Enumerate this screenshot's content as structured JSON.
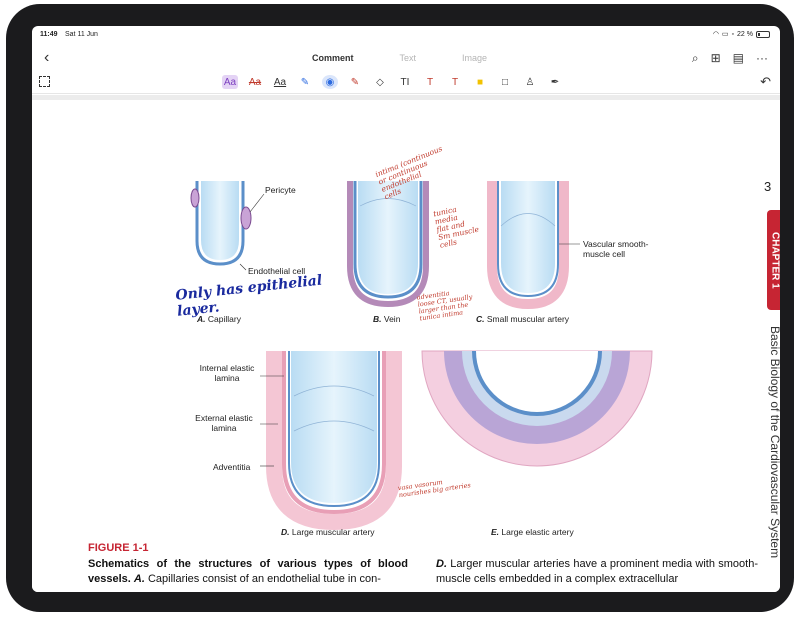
{
  "status": {
    "time": "11:49",
    "date": "Sat 11 Jun",
    "battery": "22 %"
  },
  "nav": {
    "back": "‹",
    "tabs": [
      "Comment",
      "Text",
      "Image"
    ]
  },
  "toolbar": {
    "tools": [
      {
        "name": "highlight-text-tool",
        "glyph": "Aa",
        "color": "#7b3fbf"
      },
      {
        "name": "strikethrough-tool",
        "glyph": "Aa",
        "color": "#c0392b"
      },
      {
        "name": "underline-tool",
        "glyph": "Aa",
        "color": "#333333"
      },
      {
        "name": "pen-tool",
        "glyph": "✎",
        "color": "#2d6be0"
      },
      {
        "name": "marker-tool",
        "glyph": "◉",
        "color": "#2d6be0"
      },
      {
        "name": "highlighter-tool",
        "glyph": "✎",
        "color": "#c0392b"
      },
      {
        "name": "eraser-tool",
        "glyph": "◇",
        "color": "#333333"
      },
      {
        "name": "text-tool",
        "glyph": "TI",
        "color": "#333333"
      },
      {
        "name": "textbox-tool",
        "glyph": "T",
        "color": "#c0392b"
      },
      {
        "name": "callout-tool",
        "glyph": "T",
        "color": "#c0392b"
      },
      {
        "name": "sticky-note-tool",
        "glyph": "■",
        "color": "#f2c200"
      },
      {
        "name": "shape-tool",
        "glyph": "□",
        "color": "#333333"
      },
      {
        "name": "stamp-tool",
        "glyph": "♙",
        "color": "#333333"
      },
      {
        "name": "signature-tool",
        "glyph": "✒",
        "color": "#333333"
      }
    ],
    "undo": "↶"
  },
  "page": {
    "page_number": "3",
    "chapter_tab": "CHAPTER 1",
    "running_head": "Basic Biology of the Cardiovascular System",
    "labels": {
      "pericyte": "Pericyte",
      "endothelial": "Endothelial cell",
      "vascular_smooth": "Vascular smooth-\nmuscle cell",
      "internal_elastic": "Internal elastic\nlamina",
      "external_elastic": "External elastic\nlamina",
      "adventitia": "Adventitia"
    },
    "captions": {
      "a_letter": "A.",
      "a_text": "Capillary",
      "b_letter": "B.",
      "b_text": "Vein",
      "c_letter": "C.",
      "c_text": "Small muscular artery",
      "d_letter": "D.",
      "d_text": "Large muscular artery",
      "e_letter": "E.",
      "e_text": "Large elastic artery"
    },
    "figure_title": "FIGURE 1-1",
    "left_bold": "Schematics of the structures of various types of blood vessels.",
    "left_italic": "A.",
    "left_rest": " Capillaries consist of an endothelial tube in con-",
    "right_italic": "D.",
    "right_rest": " Larger muscular arteries have a prominent media with smooth-muscle cells embedded in a complex extracellular"
  },
  "annotations": {
    "blue_note": "Only has epithelial\nlayer.",
    "red_intima": "intima (continuous\nor continuous\nendothelial\ncells",
    "red_media": "tunica\nmedia\nflat and\nSm muscle\ncells",
    "red_adventitia": "adventitia\nloose CT, usually\nlarger than the\ntunica intima",
    "red_vasa": "vasa vasorum\nnourishes big arteries"
  }
}
